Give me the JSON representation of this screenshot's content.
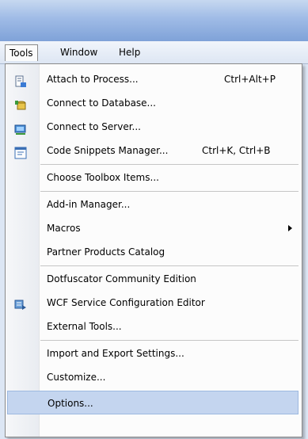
{
  "menubar": {
    "tools": "Tools",
    "window": "Window",
    "help": "Help"
  },
  "menu": {
    "attach": {
      "label": "Attach to Process...",
      "shortcut": "Ctrl+Alt+P",
      "icon": "attach-process-icon"
    },
    "connect_db": {
      "label": "Connect to Database...",
      "icon": "database-plug-icon"
    },
    "connect_server": {
      "label": "Connect to Server...",
      "icon": "server-connect-icon"
    },
    "snippets": {
      "label": "Code Snippets Manager...",
      "shortcut": "Ctrl+K, Ctrl+B",
      "icon": "snippets-icon"
    },
    "toolbox": {
      "label": "Choose Toolbox Items..."
    },
    "addin": {
      "label": "Add-in Manager..."
    },
    "macros": {
      "label": "Macros"
    },
    "partner": {
      "label": "Partner Products Catalog"
    },
    "dotfuscator": {
      "label": "Dotfuscator Community Edition"
    },
    "wcf": {
      "label": "WCF Service Configuration Editor",
      "icon": "wcf-editor-icon"
    },
    "external": {
      "label": "External Tools..."
    },
    "import_export": {
      "label": "Import and Export Settings..."
    },
    "customize": {
      "label": "Customize..."
    },
    "options": {
      "label": "Options..."
    }
  },
  "colors": {
    "highlight": "#c4d5ef",
    "titlebar": "#9fbbe6",
    "menu_bg": "#fcfcfc"
  }
}
